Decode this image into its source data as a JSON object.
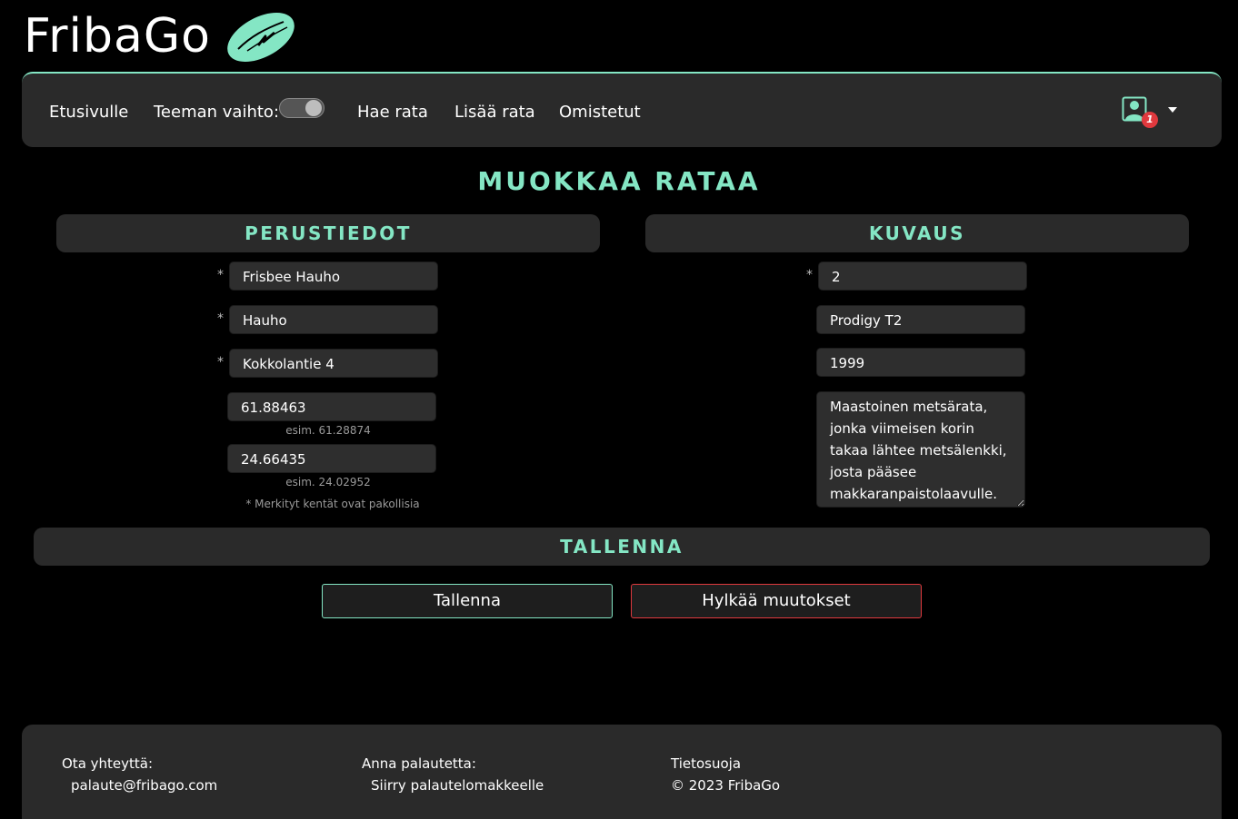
{
  "brand": {
    "name": "FribaGo",
    "accent": "#84e6c4"
  },
  "nav": {
    "home": "Etusivulle",
    "theme_label": "Teeman vaihto:",
    "search": "Hae rata",
    "add": "Lisää rata",
    "owned": "Omistetut",
    "notifications": "1",
    "theme_toggle_on": true
  },
  "title": "MUOKKAA RATAA",
  "basic": {
    "header": "PERUSTIEDOT",
    "name": "Frisbee Hauho",
    "city": "Hauho",
    "address": "Kokkolantie 4",
    "lat": "61.88463",
    "lat_hint": "esim. 61.28874",
    "lon": "24.66435",
    "lon_hint": "esim. 24.02952",
    "required_note": "* Merkityt kentät ovat pakollisia"
  },
  "description": {
    "header": "KUVAUS",
    "holes": "2",
    "baskets": "Prodigy T2",
    "year": "1999",
    "text": "Maastoinen metsärata, jonka viimeisen korin takaa lähtee metsälenkki, josta pääsee makkaranpaistolaavulle."
  },
  "save": {
    "header": "TALLENNA",
    "save_button": "Tallenna",
    "discard_button": "Hylkää muutokset"
  },
  "footer": {
    "contact_label": "Ota yhteyttä:",
    "contact_email": "palaute@fribago.com",
    "feedback_label": "Anna palautetta:",
    "feedback_link": "Siirry palautelomakkeelle",
    "privacy": "Tietosuoja",
    "copyright": "© 2023 FribaGo"
  }
}
